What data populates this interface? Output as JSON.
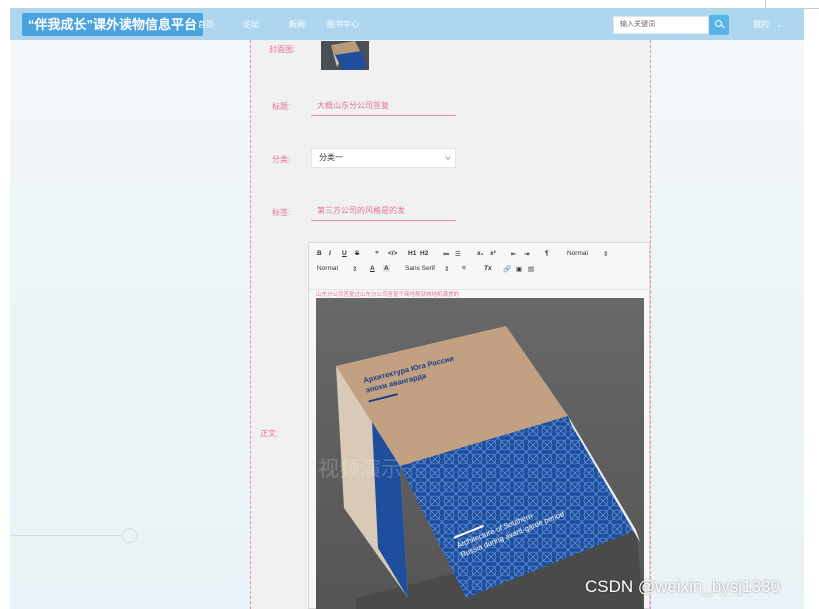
{
  "navbar": {
    "brand": "“伴我成长”课外读物信息平台",
    "links": [
      "首页",
      "论坛",
      "新闻",
      "图书中心"
    ],
    "search_placeholder": "输入关键词",
    "mine": "我的"
  },
  "form": {
    "cover_label": "封面图:",
    "title_label": "标题:",
    "title_value": "大概山东分公司答复",
    "category_label": "分类:",
    "category_value": "分类一",
    "tags_label": "标签:",
    "tags_value": "第三方公司的风格是的发",
    "content_label": "正文:"
  },
  "editor": {
    "toolbar_row1": [
      "B",
      "I",
      "U",
      "S",
      "❞",
      "</>",
      "H1",
      "H2",
      "≔",
      "☰",
      "x₁",
      "x²",
      "⇤",
      "⇥",
      "¶",
      "Normal",
      "⇕"
    ],
    "toolbar_row2": [
      "Normal",
      "⇕",
      "A",
      "A",
      "Sans Serif",
      "⇕",
      "≡",
      "Tx",
      "🔗",
      "▣",
      "▤"
    ],
    "content_text": "山东分公司答复过山东分公司答复个商地那就林地机满意的",
    "book_title_ru_1": "Архитектура Юга России",
    "book_title_ru_2": "эпохи авангарда",
    "book_title_en_1": "Architecture of Southern",
    "book_title_en_2": "Russia during avant-garde period"
  },
  "overlay_text": "视频演示",
  "watermark": "CSDN @weixin_bysj1330",
  "colors": {
    "navbar_bg": "#aed6ef",
    "brand_bg": "#4aa3df",
    "accent_pink": "#e1739b",
    "search_button": "#58b3e8"
  },
  "icons": [
    "search-icon",
    "chevron-down-icon"
  ]
}
